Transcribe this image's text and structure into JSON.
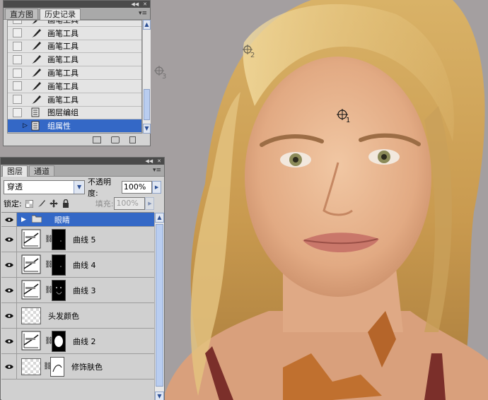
{
  "history_panel": {
    "tabs": [
      "直方图",
      "历史记录"
    ],
    "active_tab": 1,
    "items": [
      {
        "label": "画笔工具",
        "icon": "brush-icon",
        "selected": false
      },
      {
        "label": "画笔工具",
        "icon": "brush-icon",
        "selected": false
      },
      {
        "label": "画笔工具",
        "icon": "brush-icon",
        "selected": false
      },
      {
        "label": "画笔工具",
        "icon": "brush-icon",
        "selected": false
      },
      {
        "label": "画笔工具",
        "icon": "brush-icon",
        "selected": false
      },
      {
        "label": "画笔工具",
        "icon": "brush-icon",
        "selected": false
      },
      {
        "label": "画笔工具",
        "icon": "brush-icon",
        "selected": false
      },
      {
        "label": "图层编组",
        "icon": "layer-group-icon",
        "selected": false
      },
      {
        "label": "组属性",
        "icon": "layer-properties-icon",
        "selected": true
      }
    ],
    "footer_icons": [
      "new-document-from-state-icon",
      "snapshot-icon",
      "delete-state-icon"
    ]
  },
  "layers_panel": {
    "tabs": [
      "图层",
      "通道"
    ],
    "active_tab": 0,
    "blend_mode": "穿透",
    "opacity_label": "不透明度:",
    "opacity_value": "100%",
    "lock_label": "锁定:",
    "fill_label": "填充:",
    "fill_value": "100%",
    "layers": [
      {
        "name": "眼睛",
        "kind": "group",
        "selected": true
      },
      {
        "name": "曲线 5",
        "kind": "curves",
        "mask": "black"
      },
      {
        "name": "曲线 4",
        "kind": "curves",
        "mask": "black"
      },
      {
        "name": "曲线 3",
        "kind": "curves",
        "mask": "black-eyes"
      },
      {
        "name": "头发颜色",
        "kind": "pixel"
      },
      {
        "name": "曲线 2",
        "kind": "curves",
        "mask": "face"
      },
      {
        "name": "修饰肤色",
        "kind": "pixel-masked",
        "mask": "white-outline"
      }
    ]
  },
  "canvas": {
    "sample_markers": [
      "1",
      "2",
      "3"
    ],
    "background_color": "#a49fa0",
    "accent_selected": "#3468c6"
  }
}
